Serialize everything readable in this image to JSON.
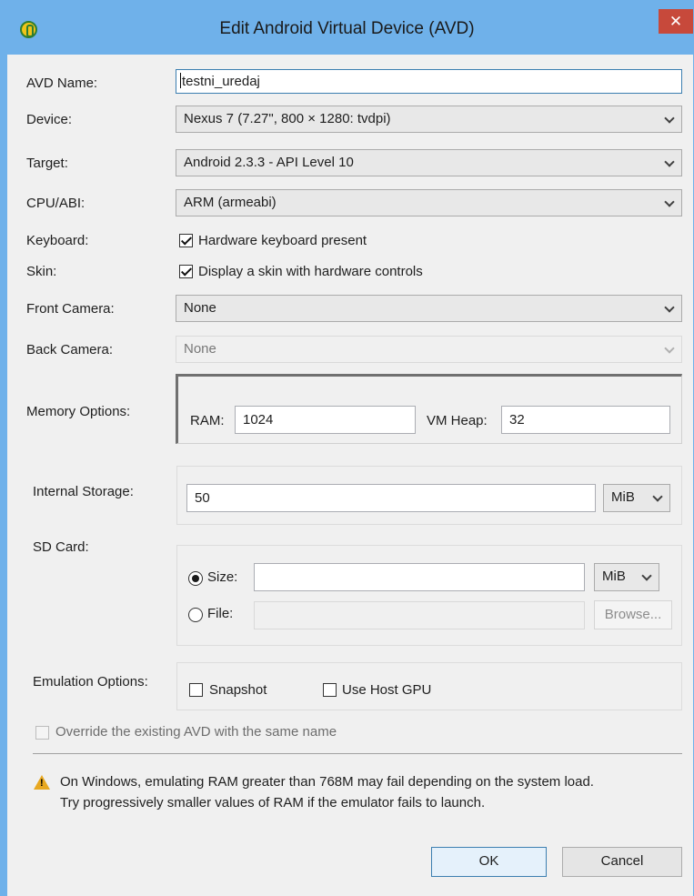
{
  "window": {
    "title": "Edit Android Virtual Device (AVD)",
    "close_glyph": "✕"
  },
  "form": {
    "avd_name": {
      "label": "AVD Name:",
      "value": "testni_uredaj"
    },
    "device": {
      "label": "Device:",
      "value": "Nexus 7 (7.27\", 800 × 1280: tvdpi)"
    },
    "target": {
      "label": "Target:",
      "value": "Android 2.3.3 - API Level 10"
    },
    "cpu_abi": {
      "label": "CPU/ABI:",
      "value": "ARM (armeabi)"
    },
    "keyboard": {
      "label": "Keyboard:",
      "checkbox_label": "Hardware keyboard present",
      "checked": true
    },
    "skin": {
      "label": "Skin:",
      "checkbox_label": "Display a skin with hardware controls",
      "checked": true
    },
    "front_camera": {
      "label": "Front Camera:",
      "value": "None"
    },
    "back_camera": {
      "label": "Back Camera:",
      "value": "None"
    },
    "memory": {
      "label": "Memory Options:",
      "ram_label": "RAM:",
      "ram_value": "1024",
      "vm_heap_label": "VM Heap:",
      "vm_heap_value": "32"
    },
    "internal_storage": {
      "label": "Internal Storage:",
      "value": "50",
      "unit": "MiB"
    },
    "sd_card": {
      "label": "SD Card:",
      "size_label": "Size:",
      "size_value": "",
      "size_unit": "MiB",
      "file_label": "File:",
      "file_value": "",
      "browse_label": "Browse...",
      "selected": "size"
    },
    "emulation": {
      "label": "Emulation Options:",
      "snapshot_label": "Snapshot",
      "snapshot_checked": false,
      "gpu_label": "Use Host GPU",
      "gpu_checked": false
    },
    "override": {
      "label": "Override the existing AVD with the same name",
      "checked": false
    }
  },
  "warning": {
    "icon": "warning-icon",
    "line1": "On Windows, emulating RAM greater than 768M may fail depending on the system load.",
    "line2": "Try progressively smaller values of RAM if the emulator fails to launch."
  },
  "buttons": {
    "ok": "OK",
    "cancel": "Cancel"
  },
  "colors": {
    "titlebar": "#6fb1ea",
    "close": "#c7493b",
    "dialog_bg": "#f0f0f0",
    "warning": "#e8a820"
  }
}
